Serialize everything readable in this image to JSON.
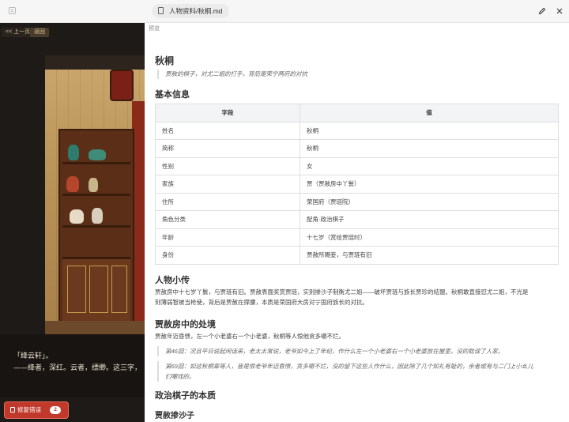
{
  "left_panel": {
    "prev_label": "<< 上一页",
    "back_label": "返回",
    "dialogue_lines": [
      "「绛云轩」。",
      "——绛者，深红。云者，缥缈。这三字，"
    ],
    "fix_button_label": "修复错误",
    "fix_count": "2"
  },
  "editor": {
    "file_tab_label": "人物资料/秋桐.md",
    "preview_label": "预览",
    "title": "秋桐",
    "subtitle_quote": "贾赦的棋子，对尤二姐的打手，背后是荣宁两府的对抗",
    "section_basic": "基本信息",
    "table": {
      "headers": [
        "字段",
        "值"
      ],
      "rows": [
        [
          "姓名",
          "秋桐"
        ],
        [
          "简称",
          "秋桐"
        ],
        [
          "性别",
          "女"
        ],
        [
          "家族",
          "贾（贾赦房中丫鬟）"
        ],
        [
          "住所",
          "荣国府（贾琏院）"
        ],
        [
          "角色分类",
          "配角·政治棋子"
        ],
        [
          "年龄",
          "十七岁（赏给贾琏时）"
        ],
        [
          "身份",
          "贾赦所赐妾，与贾琏有旧"
        ]
      ]
    },
    "section_bio": "人物小传",
    "bio_lines": [
      "贾赦房中十七岁丫鬟，与贾琏有旧。贾赦表面奖赏贾琏，实则掺沙子制衡尤二姐——破坏贾琏与族长贾珍的结盟。秋桐敢直接怼尤二姐，不光是",
      "刻薄弱智被当枪使，背后是贾赦在撑腰，本质是荣国府大房对宁国府族长的对抗。"
    ],
    "section_situation": "贾赦房中的处境",
    "situation_text": "贾赦年迈昏愦，左一个小老婆右一个小老婆，秋桐等人恨他贪多嚼不烂。",
    "quote_46": "第46回：况且平日说起闲话来，老太太常说，老爷如今上了年纪，作什么左一个小老婆右一个小老婆放在屋里，没的耽误了人家。",
    "quote_69_lines": [
      "第69回：如这秋桐辈等人，皆是恨老爷年迈昏愦，贪多嚼不烂，没的留下这些人作什么，因此除了几个知礼有耻的，余者或有与二门上小幺儿",
      "们嘲戏的。"
    ],
    "section_political": "政治棋子的本质",
    "section_shazi": "贾赦掺沙子"
  }
}
